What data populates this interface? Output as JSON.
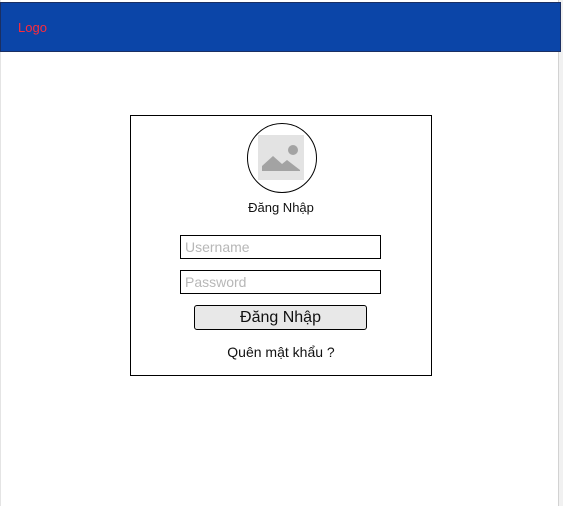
{
  "header": {
    "logo_text": "Logo",
    "background_color": "#0b45a8",
    "logo_color": "#ff2b3a"
  },
  "login_form": {
    "avatar_icon": "image-placeholder-icon",
    "title": "Đăng Nhập",
    "username": {
      "value": "",
      "placeholder": "Username"
    },
    "password": {
      "value": "",
      "placeholder": "Password"
    },
    "submit_label": "Đăng Nhập",
    "forgot_password_label": "Quên mật khẩu ?"
  }
}
